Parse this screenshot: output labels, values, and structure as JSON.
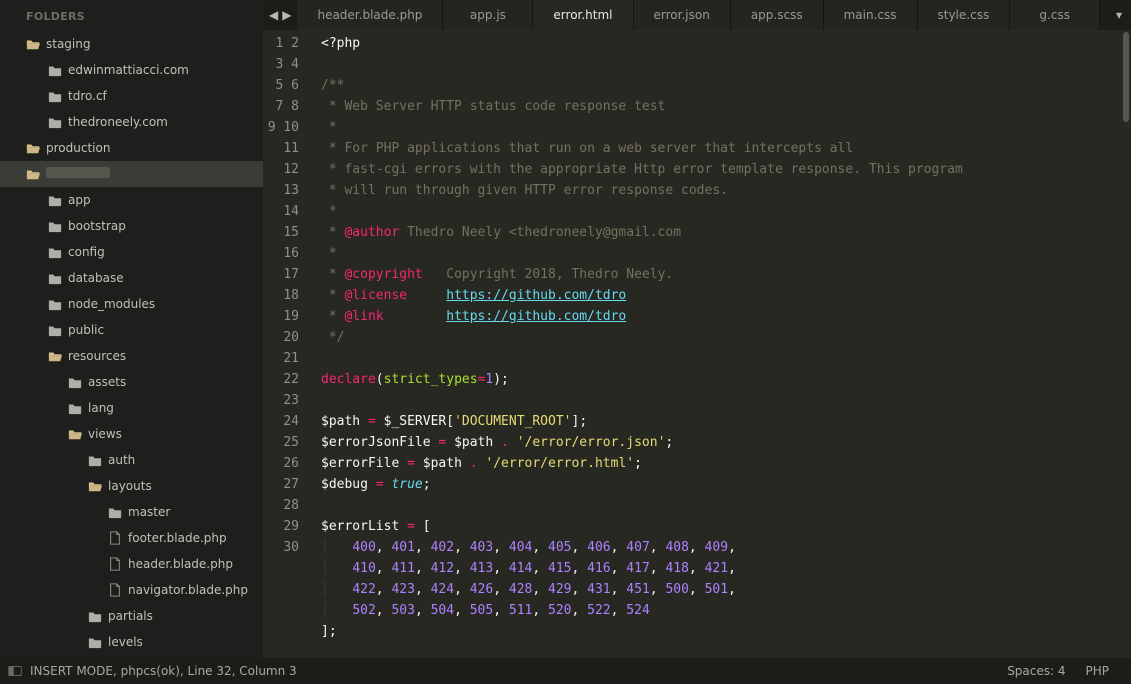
{
  "sidebar": {
    "header": "FOLDERS",
    "items": [
      {
        "label": "staging",
        "icon": "folder-open",
        "depth": 0,
        "sel": false
      },
      {
        "label": "edwinmattiacci.com",
        "icon": "folder",
        "depth": 1,
        "sel": false
      },
      {
        "label": "tdro.cf",
        "icon": "folder",
        "depth": 1,
        "sel": false
      },
      {
        "label": "thedroneely.com",
        "icon": "folder",
        "depth": 1,
        "sel": false
      },
      {
        "label": "production",
        "icon": "folder-open",
        "depth": 0,
        "sel": false
      },
      {
        "label": "",
        "icon": "folder-open",
        "depth": 0,
        "sel": true
      },
      {
        "label": "app",
        "icon": "folder",
        "depth": 1,
        "sel": false
      },
      {
        "label": "bootstrap",
        "icon": "folder",
        "depth": 1,
        "sel": false
      },
      {
        "label": "config",
        "icon": "folder",
        "depth": 1,
        "sel": false
      },
      {
        "label": "database",
        "icon": "folder",
        "depth": 1,
        "sel": false
      },
      {
        "label": "node_modules",
        "icon": "folder",
        "depth": 1,
        "sel": false
      },
      {
        "label": "public",
        "icon": "folder",
        "depth": 1,
        "sel": false
      },
      {
        "label": "resources",
        "icon": "folder-open",
        "depth": 1,
        "sel": false
      },
      {
        "label": "assets",
        "icon": "folder",
        "depth": 2,
        "sel": false
      },
      {
        "label": "lang",
        "icon": "folder",
        "depth": 2,
        "sel": false
      },
      {
        "label": "views",
        "icon": "folder-open",
        "depth": 2,
        "sel": false
      },
      {
        "label": "auth",
        "icon": "folder",
        "depth": 3,
        "sel": false
      },
      {
        "label": "layouts",
        "icon": "folder-open",
        "depth": 3,
        "sel": false
      },
      {
        "label": "master",
        "icon": "folder",
        "depth": 4,
        "sel": false
      },
      {
        "label": "footer.blade.php",
        "icon": "file",
        "depth": 4,
        "sel": false
      },
      {
        "label": "header.blade.php",
        "icon": "file",
        "depth": 4,
        "sel": false
      },
      {
        "label": "navigator.blade.php",
        "icon": "file",
        "depth": 4,
        "sel": false
      },
      {
        "label": "partials",
        "icon": "folder",
        "depth": 3,
        "sel": false
      },
      {
        "label": "levels",
        "icon": "folder",
        "depth": 3,
        "sel": false
      }
    ]
  },
  "tabs": [
    {
      "label": "header.blade.php",
      "active": false
    },
    {
      "label": "app.js",
      "active": false
    },
    {
      "label": "error.html",
      "active": true
    },
    {
      "label": "error.json",
      "active": false
    },
    {
      "label": "app.scss",
      "active": false
    },
    {
      "label": "main.css",
      "active": false
    },
    {
      "label": "style.css",
      "active": false
    },
    {
      "label": "g.css",
      "active": false
    }
  ],
  "code": {
    "first_line": 1,
    "last_line": 30,
    "lines": [
      [
        {
          "c": "pun",
          "t": "<?"
        },
        {
          "c": "var",
          "t": "php"
        }
      ],
      [],
      [
        {
          "c": "comment",
          "t": "/**"
        }
      ],
      [
        {
          "c": "comment",
          "t": " * Web Server HTTP status code response test"
        }
      ],
      [
        {
          "c": "comment",
          "t": " *"
        }
      ],
      [
        {
          "c": "comment",
          "t": " * For PHP applications that run on a web server that intercepts all"
        }
      ],
      [
        {
          "c": "comment",
          "t": " * fast-cgi errors with the appropriate Http error template response. This program"
        }
      ],
      [
        {
          "c": "comment",
          "t": " * will run through given HTTP error response codes."
        }
      ],
      [
        {
          "c": "comment",
          "t": " *"
        }
      ],
      [
        {
          "c": "comment",
          "t": " * "
        },
        {
          "c": "tag",
          "t": "@author"
        },
        {
          "c": "comment",
          "t": " Thedro Neely <thedroneely@gmail.com"
        }
      ],
      [
        {
          "c": "comment",
          "t": " *"
        }
      ],
      [
        {
          "c": "comment",
          "t": " * "
        },
        {
          "c": "tag",
          "t": "@copyright"
        },
        {
          "c": "comment",
          "t": "   Copyright 2018, Thedro Neely."
        }
      ],
      [
        {
          "c": "comment",
          "t": " * "
        },
        {
          "c": "tag",
          "t": "@license"
        },
        {
          "c": "comment",
          "t": "     "
        },
        {
          "c": "link",
          "t": "https://github.com/tdro"
        }
      ],
      [
        {
          "c": "comment",
          "t": " * "
        },
        {
          "c": "tag",
          "t": "@link"
        },
        {
          "c": "comment",
          "t": "        "
        },
        {
          "c": "link",
          "t": "https://github.com/tdro"
        }
      ],
      [
        {
          "c": "comment",
          "t": " */"
        }
      ],
      [],
      [
        {
          "c": "kw",
          "t": "declare"
        },
        {
          "c": "br",
          "t": "("
        },
        {
          "c": "fn",
          "t": "strict_types"
        },
        {
          "c": "op",
          "t": "="
        },
        {
          "c": "num",
          "t": "1"
        },
        {
          "c": "br",
          "t": ")"
        },
        {
          "c": "pun",
          "t": ";"
        }
      ],
      [],
      [
        {
          "c": "var",
          "t": "$path"
        },
        {
          "c": "pun",
          "t": " "
        },
        {
          "c": "op",
          "t": "="
        },
        {
          "c": "pun",
          "t": " "
        },
        {
          "c": "var",
          "t": "$_SERVER["
        },
        {
          "c": "str",
          "t": "'DOCUMENT_ROOT'"
        },
        {
          "c": "var",
          "t": "]"
        },
        {
          "c": "pun",
          "t": ";"
        }
      ],
      [
        {
          "c": "var",
          "t": "$errorJsonFile"
        },
        {
          "c": "pun",
          "t": " "
        },
        {
          "c": "op",
          "t": "="
        },
        {
          "c": "pun",
          "t": " "
        },
        {
          "c": "var",
          "t": "$path"
        },
        {
          "c": "pun",
          "t": " "
        },
        {
          "c": "op",
          "t": "."
        },
        {
          "c": "pun",
          "t": " "
        },
        {
          "c": "str",
          "t": "'/error/error.json'"
        },
        {
          "c": "pun",
          "t": ";"
        }
      ],
      [
        {
          "c": "var",
          "t": "$errorFile"
        },
        {
          "c": "pun",
          "t": " "
        },
        {
          "c": "op",
          "t": "="
        },
        {
          "c": "pun",
          "t": " "
        },
        {
          "c": "var",
          "t": "$path"
        },
        {
          "c": "pun",
          "t": " "
        },
        {
          "c": "op",
          "t": "."
        },
        {
          "c": "pun",
          "t": " "
        },
        {
          "c": "str",
          "t": "'/error/error.html'"
        },
        {
          "c": "pun",
          "t": ";"
        }
      ],
      [
        {
          "c": "var",
          "t": "$debug"
        },
        {
          "c": "pun",
          "t": " "
        },
        {
          "c": "op",
          "t": "="
        },
        {
          "c": "pun",
          "t": " "
        },
        {
          "c": "const",
          "t": "true"
        },
        {
          "c": "pun",
          "t": ";"
        }
      ],
      [],
      [
        {
          "c": "var",
          "t": "$errorList"
        },
        {
          "c": "pun",
          "t": " "
        },
        {
          "c": "op",
          "t": "="
        },
        {
          "c": "pun",
          "t": " ["
        }
      ],
      [
        {
          "c": "ig",
          "t": "│   "
        },
        {
          "c": "num",
          "t": "400"
        },
        {
          "c": "pun",
          "t": ", "
        },
        {
          "c": "num",
          "t": "401"
        },
        {
          "c": "pun",
          "t": ", "
        },
        {
          "c": "num",
          "t": "402"
        },
        {
          "c": "pun",
          "t": ", "
        },
        {
          "c": "num",
          "t": "403"
        },
        {
          "c": "pun",
          "t": ", "
        },
        {
          "c": "num",
          "t": "404"
        },
        {
          "c": "pun",
          "t": ", "
        },
        {
          "c": "num",
          "t": "405"
        },
        {
          "c": "pun",
          "t": ", "
        },
        {
          "c": "num",
          "t": "406"
        },
        {
          "c": "pun",
          "t": ", "
        },
        {
          "c": "num",
          "t": "407"
        },
        {
          "c": "pun",
          "t": ", "
        },
        {
          "c": "num",
          "t": "408"
        },
        {
          "c": "pun",
          "t": ", "
        },
        {
          "c": "num",
          "t": "409"
        },
        {
          "c": "pun",
          "t": ","
        }
      ],
      [
        {
          "c": "ig",
          "t": "│   "
        },
        {
          "c": "num",
          "t": "410"
        },
        {
          "c": "pun",
          "t": ", "
        },
        {
          "c": "num",
          "t": "411"
        },
        {
          "c": "pun",
          "t": ", "
        },
        {
          "c": "num",
          "t": "412"
        },
        {
          "c": "pun",
          "t": ", "
        },
        {
          "c": "num",
          "t": "413"
        },
        {
          "c": "pun",
          "t": ", "
        },
        {
          "c": "num",
          "t": "414"
        },
        {
          "c": "pun",
          "t": ", "
        },
        {
          "c": "num",
          "t": "415"
        },
        {
          "c": "pun",
          "t": ", "
        },
        {
          "c": "num",
          "t": "416"
        },
        {
          "c": "pun",
          "t": ", "
        },
        {
          "c": "num",
          "t": "417"
        },
        {
          "c": "pun",
          "t": ", "
        },
        {
          "c": "num",
          "t": "418"
        },
        {
          "c": "pun",
          "t": ", "
        },
        {
          "c": "num",
          "t": "421"
        },
        {
          "c": "pun",
          "t": ","
        }
      ],
      [
        {
          "c": "ig",
          "t": "│   "
        },
        {
          "c": "num",
          "t": "422"
        },
        {
          "c": "pun",
          "t": ", "
        },
        {
          "c": "num",
          "t": "423"
        },
        {
          "c": "pun",
          "t": ", "
        },
        {
          "c": "num",
          "t": "424"
        },
        {
          "c": "pun",
          "t": ", "
        },
        {
          "c": "num",
          "t": "426"
        },
        {
          "c": "pun",
          "t": ", "
        },
        {
          "c": "num",
          "t": "428"
        },
        {
          "c": "pun",
          "t": ", "
        },
        {
          "c": "num",
          "t": "429"
        },
        {
          "c": "pun",
          "t": ", "
        },
        {
          "c": "num",
          "t": "431"
        },
        {
          "c": "pun",
          "t": ", "
        },
        {
          "c": "num",
          "t": "451"
        },
        {
          "c": "pun",
          "t": ", "
        },
        {
          "c": "num",
          "t": "500"
        },
        {
          "c": "pun",
          "t": ", "
        },
        {
          "c": "num",
          "t": "501"
        },
        {
          "c": "pun",
          "t": ","
        }
      ],
      [
        {
          "c": "ig",
          "t": "│   "
        },
        {
          "c": "num",
          "t": "502"
        },
        {
          "c": "pun",
          "t": ", "
        },
        {
          "c": "num",
          "t": "503"
        },
        {
          "c": "pun",
          "t": ", "
        },
        {
          "c": "num",
          "t": "504"
        },
        {
          "c": "pun",
          "t": ", "
        },
        {
          "c": "num",
          "t": "505"
        },
        {
          "c": "pun",
          "t": ", "
        },
        {
          "c": "num",
          "t": "511"
        },
        {
          "c": "pun",
          "t": ", "
        },
        {
          "c": "num",
          "t": "520"
        },
        {
          "c": "pun",
          "t": ", "
        },
        {
          "c": "num",
          "t": "522"
        },
        {
          "c": "pun",
          "t": ", "
        },
        {
          "c": "num",
          "t": "524"
        }
      ],
      [
        {
          "c": "pun",
          "t": "];"
        }
      ],
      []
    ]
  },
  "status": {
    "left": "INSERT MODE, phpcs(ok), Line 32, Column 3",
    "spaces": "Spaces: 4",
    "lang": "PHP"
  }
}
